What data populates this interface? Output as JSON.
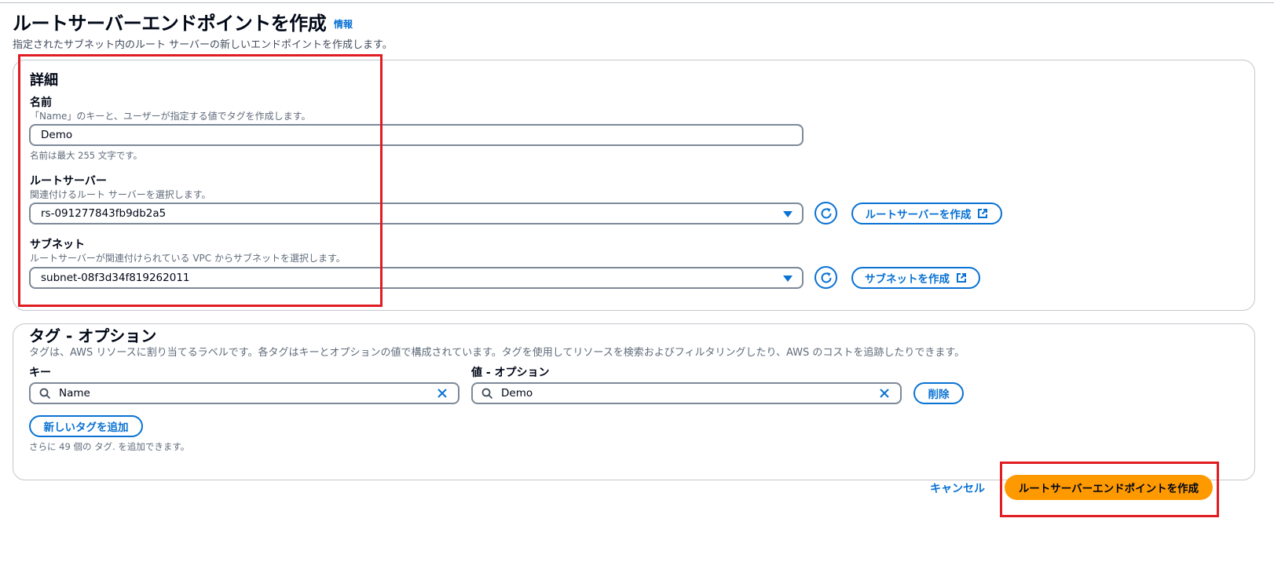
{
  "page": {
    "title": "ルートサーバーエンドポイントを作成",
    "info_link": "情報",
    "description": "指定されたサブネット内のルート サーバーの新しいエンドポイントを作成します。"
  },
  "details": {
    "heading": "詳細",
    "name": {
      "label": "名前",
      "description": "「Name」のキーと、ユーザーが指定する値でタグを作成します。",
      "value": "Demo",
      "constraint": "名前は最大 255 文字です。"
    },
    "route_server": {
      "label": "ルートサーバー",
      "description": "関連付けるルート サーバーを選択します。",
      "value": "rs-091277843fb9db2a5",
      "create_button": "ルートサーバーを作成"
    },
    "subnet": {
      "label": "サブネット",
      "description": "ルートサーバーが関連付けられている VPC からサブネットを選択します。",
      "value": "subnet-08f3d34f819262011",
      "create_button": "サブネットを作成"
    }
  },
  "tags": {
    "heading": "タグ - オプション",
    "description": "タグは、AWS リソースに割り当てるラベルです。各タグはキーとオプションの値で構成されています。タグを使用してリソースを検索およびフィルタリングしたり、AWS のコストを追跡したりできます。",
    "key_label": "キー",
    "value_label": "値 - オプション",
    "rows": [
      {
        "key": "Name",
        "value": "Demo",
        "remove_label": "削除"
      }
    ],
    "add_button": "新しいタグを追加",
    "remaining": "さらに 49 個の タグ. を追加できます。"
  },
  "footer": {
    "cancel": "キャンセル",
    "submit": "ルートサーバーエンドポイントを作成"
  },
  "colors": {
    "link": "#0972d3",
    "primary": "#ff9900",
    "annotation": "#e11d24"
  }
}
